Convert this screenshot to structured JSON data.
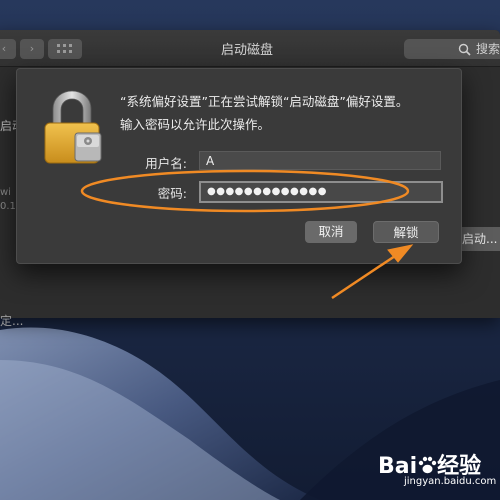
{
  "window": {
    "title": "启动磁盘",
    "nav_back": "‹",
    "nav_forward": "›",
    "grid_icon": "grid-icon",
    "search_placeholder": "搜索",
    "fragments": {
      "left_top": "启动",
      "left_mid1": "wi",
      "left_mid2": "0.1",
      "left_bottom": "定..."
    },
    "restart_button": "新启动..."
  },
  "dialog": {
    "icon": "lock-icon",
    "message": "“系统偏好设置”正在尝试解锁“启动磁盘”偏好设置。",
    "instruction": "输入密码以允许此次操作。",
    "username_label": "用户名:",
    "username_value": "A",
    "password_label": "密码:",
    "password_value": "●●●●●●●●●●●●●",
    "cancel_button": "取消",
    "unlock_button": "解锁"
  },
  "annotation": {
    "color": "#f08a24",
    "ellipse_target": "password-field",
    "arrow_target": "unlock-button"
  },
  "watermark": {
    "main_left": "Bai",
    "main_right": "经验",
    "sub": "jingyan.baidu.com"
  }
}
